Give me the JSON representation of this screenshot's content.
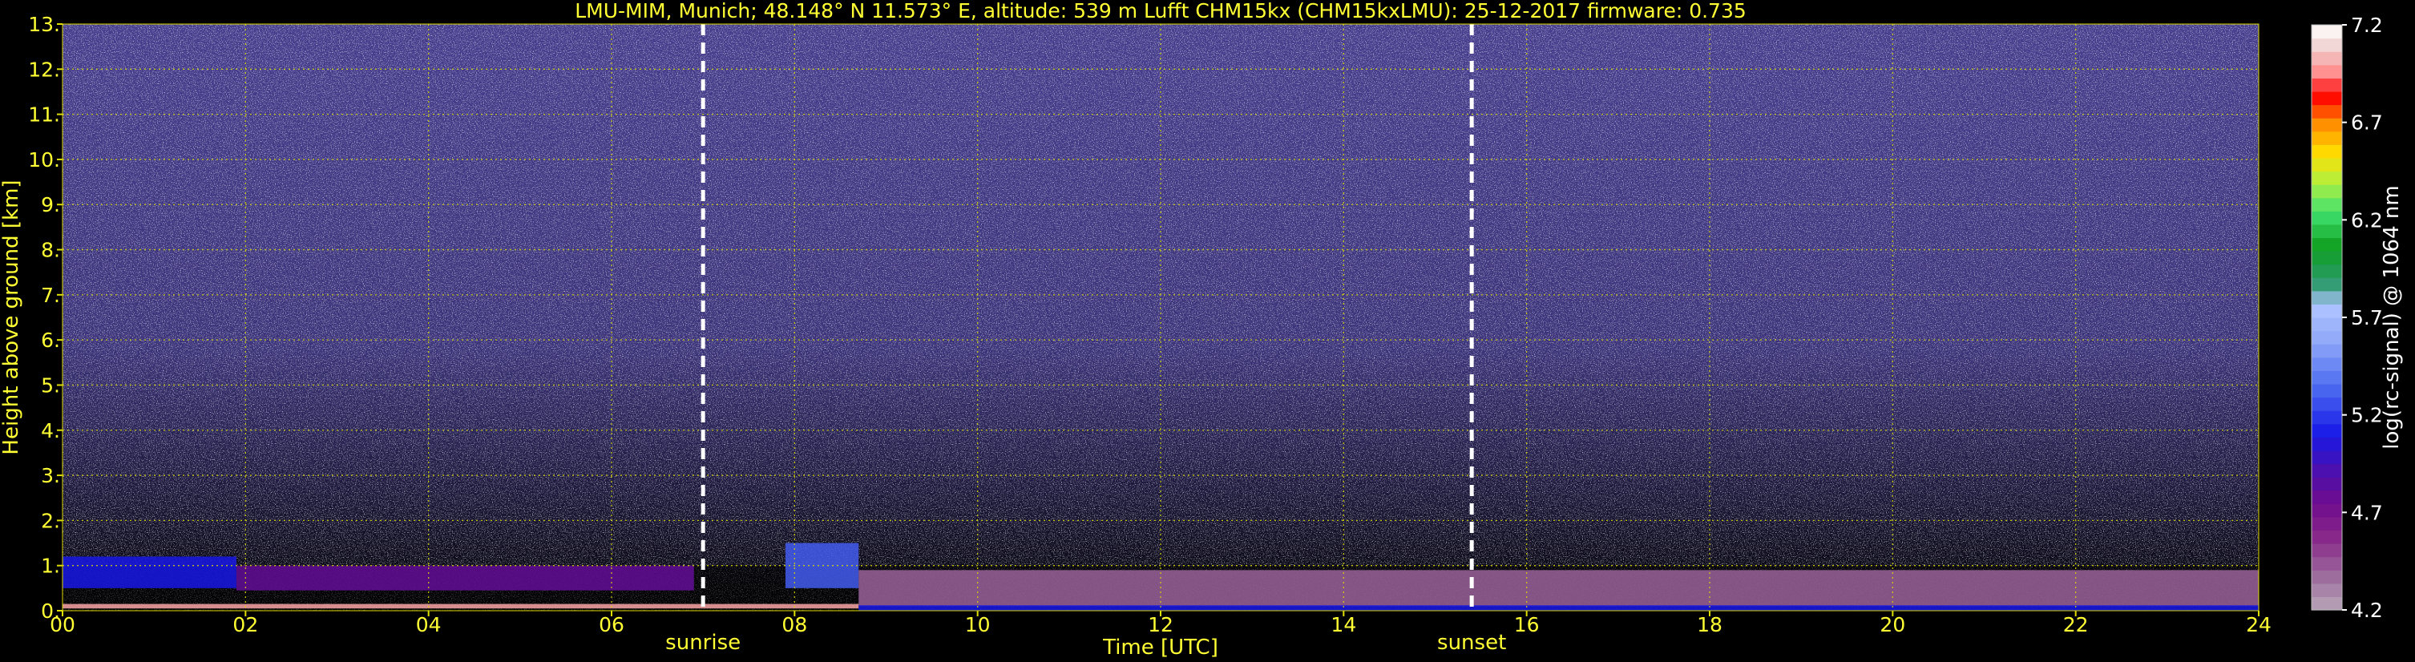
{
  "chart_data": {
    "type": "heatmap",
    "title": "LMU-MIM, Munich; 48.148° N 11.573° E, altitude: 539 m     Lufft CHM15kx (CHM15kxLMU): 25-12-2017     firmware: 0.735",
    "xlabel": "Time [UTC]",
    "ylabel": "Height above ground [km]",
    "xlim": [
      0,
      24
    ],
    "ylim": [
      0,
      13
    ],
    "x_ticks": [
      "00",
      "02",
      "04",
      "06",
      "08",
      "10",
      "12",
      "14",
      "16",
      "18",
      "20",
      "22",
      "24"
    ],
    "y_ticks": [
      "0.",
      "1.",
      "2.",
      "3.",
      "4.",
      "5.",
      "6.",
      "7.",
      "8.",
      "9.",
      "10.",
      "11.",
      "12.",
      "13."
    ],
    "grid": true,
    "colorbar": {
      "label": "log(rc-signal) @ 1064 nm",
      "ticks": [
        "4.2",
        "4.7",
        "5.2",
        "5.7",
        "6.2",
        "6.7",
        "7.2"
      ],
      "range": [
        4.2,
        7.2
      ]
    },
    "markers": [
      {
        "label": "sunrise",
        "time_utc": 7.0
      },
      {
        "label": "sunset",
        "time_utc": 15.4
      }
    ],
    "layers": [
      {
        "t0": 0.0,
        "t1": 1.9,
        "h0": 0.5,
        "h1": 1.2,
        "value": 5.1
      },
      {
        "t0": 1.9,
        "t1": 6.9,
        "h0": 0.45,
        "h1": 1.0,
        "value": 4.8
      },
      {
        "t0": 7.9,
        "t1": 8.7,
        "h0": 0.5,
        "h1": 1.5,
        "value": 5.3
      },
      {
        "t0": 0.0,
        "t1": 8.7,
        "h0": 0.05,
        "h1": 0.15,
        "value": 7.0
      },
      {
        "t0": 8.7,
        "t1": 24.0,
        "h0": 0.1,
        "h1": 0.9,
        "value": 4.4
      },
      {
        "t0": 8.7,
        "t1": 24.0,
        "h0": 0.0,
        "h1": 0.12,
        "value": 5.1
      }
    ]
  }
}
